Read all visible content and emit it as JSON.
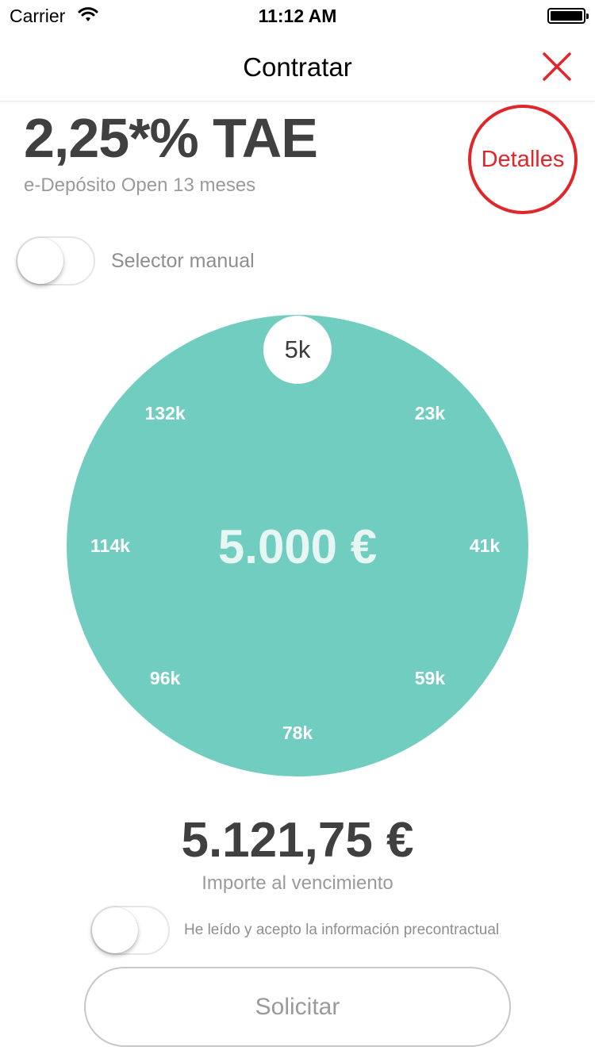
{
  "status_bar": {
    "carrier": "Carrier",
    "time": "11:12 AM"
  },
  "nav": {
    "title": "Contratar",
    "close_icon": "close-x-icon",
    "accent_color": "#e0252b"
  },
  "product": {
    "rate": "2,25*% TAE",
    "name": "e-Depósito Open 13 meses",
    "details_label": "Detalles"
  },
  "manual_selector": {
    "label": "Selector manual",
    "enabled": false
  },
  "dial": {
    "color": "#72cdc1",
    "selected_mark": "5k",
    "value": "5.000 €",
    "marks": [
      "23k",
      "41k",
      "59k",
      "78k",
      "96k",
      "114k",
      "132k"
    ]
  },
  "maturity": {
    "amount": "5.121,75 €",
    "label": "Importe al vencimiento"
  },
  "terms": {
    "label": "He leído y acepto la información precontractual",
    "accepted": false
  },
  "submit": {
    "label": "Solicitar"
  }
}
